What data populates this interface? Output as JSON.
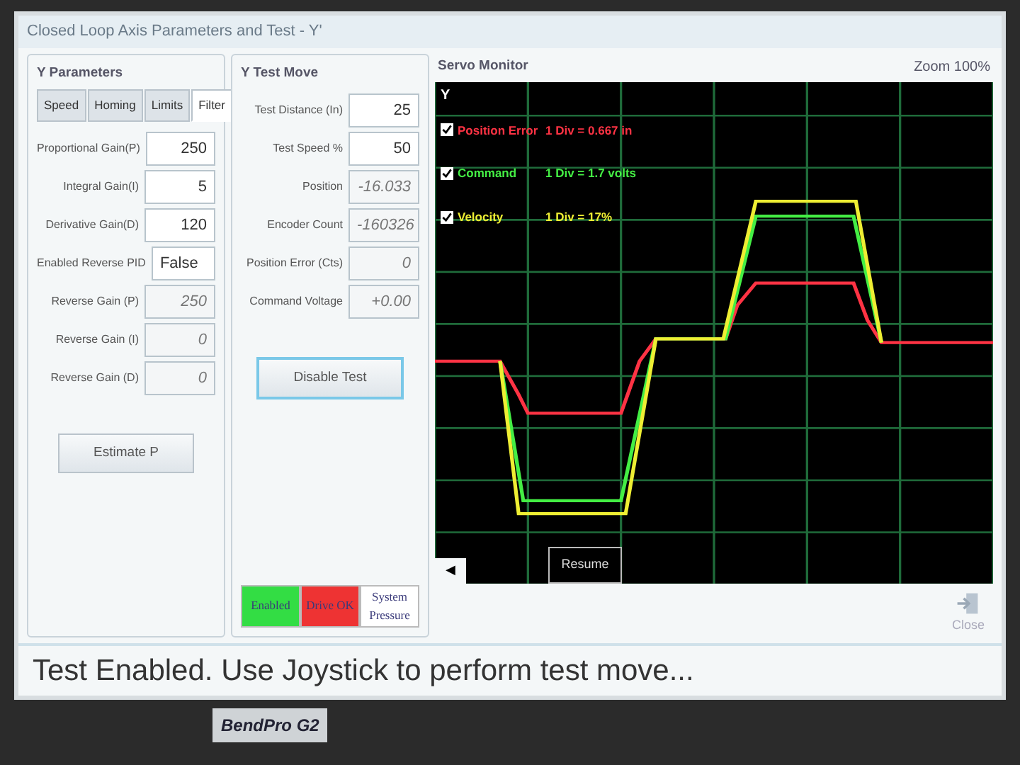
{
  "window": {
    "title": "Closed Loop Axis Parameters and Test - Y'"
  },
  "parameters": {
    "title": "Y Parameters",
    "tabs": [
      {
        "label": "Speed",
        "selected": false
      },
      {
        "label": "Homing",
        "selected": false
      },
      {
        "label": "Limits",
        "selected": false
      },
      {
        "label": "Filter",
        "selected": true
      }
    ],
    "fields": [
      {
        "label": "Proportional Gain(P)",
        "value": "250",
        "disabled": false
      },
      {
        "label": "Integral Gain(I)",
        "value": "5",
        "disabled": false
      },
      {
        "label": "Derivative Gain(D)",
        "value": "120",
        "disabled": false
      },
      {
        "label": "Enabled Reverse PID",
        "value": "False",
        "disabled": false
      },
      {
        "label": "Reverse Gain (P)",
        "value": "250",
        "disabled": true
      },
      {
        "label": "Reverse Gain (I)",
        "value": "0",
        "disabled": true
      },
      {
        "label": "Reverse Gain (D)",
        "value": "0",
        "disabled": true
      }
    ],
    "button": "Estimate P"
  },
  "test_move": {
    "title": "Y Test Move",
    "fields": [
      {
        "label": "Test Distance (In)",
        "value": "25",
        "disabled": false
      },
      {
        "label": "Test Speed %",
        "value": "50",
        "disabled": false
      },
      {
        "label": "Position",
        "value": "-16.033",
        "disabled": true
      },
      {
        "label": "Encoder Count",
        "value": "-160326",
        "disabled": true
      },
      {
        "label": "Position Error (Cts)",
        "value": "0",
        "disabled": true
      },
      {
        "label": "Command Voltage",
        "value": "+0.00",
        "disabled": true
      }
    ],
    "button": "Disable Test",
    "indicators": [
      {
        "label": "Enabled",
        "color": "#33dd44"
      },
      {
        "label": "Drive OK",
        "color": "#ee3333"
      },
      {
        "label": "System Pressure",
        "color": "#ffffff"
      }
    ]
  },
  "servo_monitor": {
    "title": "Servo Monitor",
    "zoom": "Zoom 100%",
    "axis": "Y",
    "legend": [
      {
        "label": "Position Error",
        "scale": "1 Div = 0.667 in",
        "checked": true,
        "color": "#ff3344"
      },
      {
        "label": "Command",
        "scale": "1 Div = 1.7 volts",
        "checked": true,
        "color": "#44ee44"
      },
      {
        "label": "Velocity",
        "scale": "1 Div = 17%",
        "checked": true,
        "color": "#eeee33"
      }
    ],
    "back_button": "◀",
    "resume_button": "Resume"
  },
  "close_button": {
    "label": "Close",
    "disabled": true
  },
  "status_bar": "Test Enabled.  Use Joystick to perform test move...",
  "bezel_label": "BendPro G2"
}
